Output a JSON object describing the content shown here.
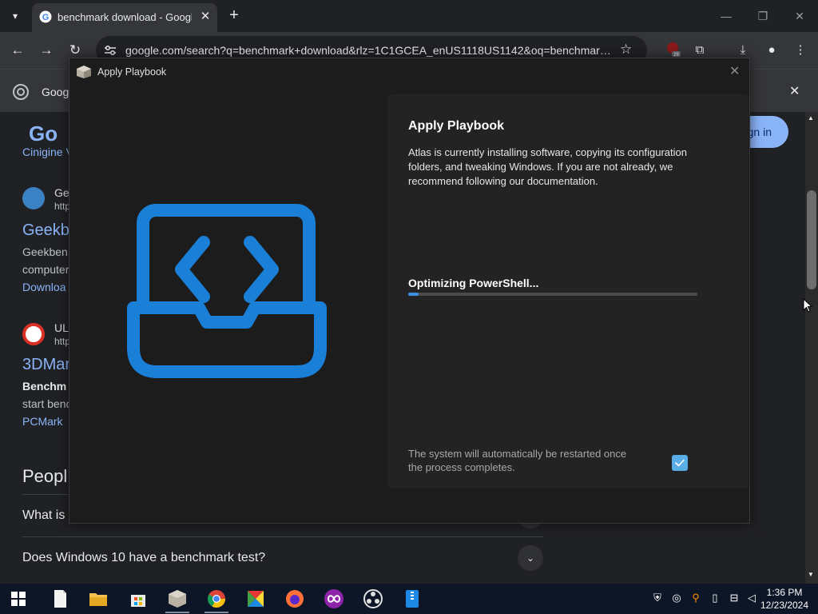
{
  "browser": {
    "tab_title": "benchmark download - Google Search",
    "tab_close": "✕",
    "new_tab": "+",
    "url": "google.com/search?q=benchmark+download&rlz=1C1GCEA_enUS1118US1142&oq=benchmark+download",
    "extension_badge": "29",
    "window_controls": {
      "minimize": "—",
      "restore": "❐",
      "close": "✕"
    }
  },
  "infobar": {
    "label": "Goog",
    "close": "✕"
  },
  "page": {
    "logo_fragment": "Go",
    "sign_in": "Sign in",
    "top_snippet": "Cinigine V",
    "results": [
      {
        "site": "Ge",
        "url": "http",
        "title": "Geekb",
        "snippet1": "Geekben",
        "snippet2": "computer",
        "link": "Downloa"
      },
      {
        "site": "UL",
        "url": "http",
        "title": "3DMar",
        "snippet1": "Benchm",
        "snippet2": "start benc",
        "link": "PCMark"
      }
    ],
    "people_heading": "Peopl",
    "faqs": [
      "What is",
      "Does Windows 10 have a benchmark test?"
    ]
  },
  "dialog": {
    "title": "Apply Playbook",
    "close": "✕",
    "heading": "Apply Playbook",
    "description": "Atlas is currently installing software, copying its configuration folders, and tweaking Windows. If you are not already, we recommend following our documentation.",
    "step_label": "Optimizing PowerShell...",
    "progress": 0.035,
    "restart_note": "The system will automatically be restarted once the process completes.",
    "restart_checked": true,
    "accent_color": "#1a7fd6"
  },
  "taskbar": {
    "time": "1:36 PM",
    "date": "12/23/2024"
  }
}
